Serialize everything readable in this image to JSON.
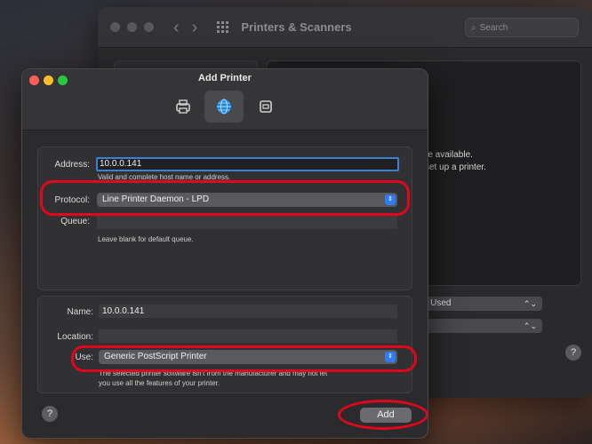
{
  "background_window": {
    "title": "Printers & Scanners",
    "search_placeholder": "Search",
    "message_line1": "re available.",
    "message_line2": "set up a printer.",
    "default_printer_value": "r Used",
    "help_label": "?"
  },
  "dialog": {
    "title": "Add Printer",
    "toolbar": [
      {
        "icon": "printer-icon",
        "active": false
      },
      {
        "icon": "globe-icon",
        "active": true
      },
      {
        "icon": "windows-printer-icon",
        "active": false
      }
    ],
    "address_label": "Address:",
    "address_value": "10.0.0.141",
    "address_hint": "Valid and complete host name or address.",
    "protocol_label": "Protocol:",
    "protocol_value": "Line Printer Daemon - LPD",
    "queue_label": "Queue:",
    "queue_value": "",
    "queue_hint": "Leave blank for default queue.",
    "name_label": "Name:",
    "name_value": "10.0.0.141",
    "location_label": "Location:",
    "location_value": "",
    "use_label": "Use:",
    "use_value": "Generic PostScript Printer",
    "use_hint_line1": "The selected printer software isn't from the manufacturer and may not let",
    "use_hint_line2": "you use all the features of your printer.",
    "help_label": "?",
    "add_label": "Add"
  },
  "colors": {
    "accent": "#2f7cf6",
    "annotation": "#e1061c",
    "close": "#ff5f57",
    "minimize": "#febc2e",
    "zoom": "#28c840"
  }
}
